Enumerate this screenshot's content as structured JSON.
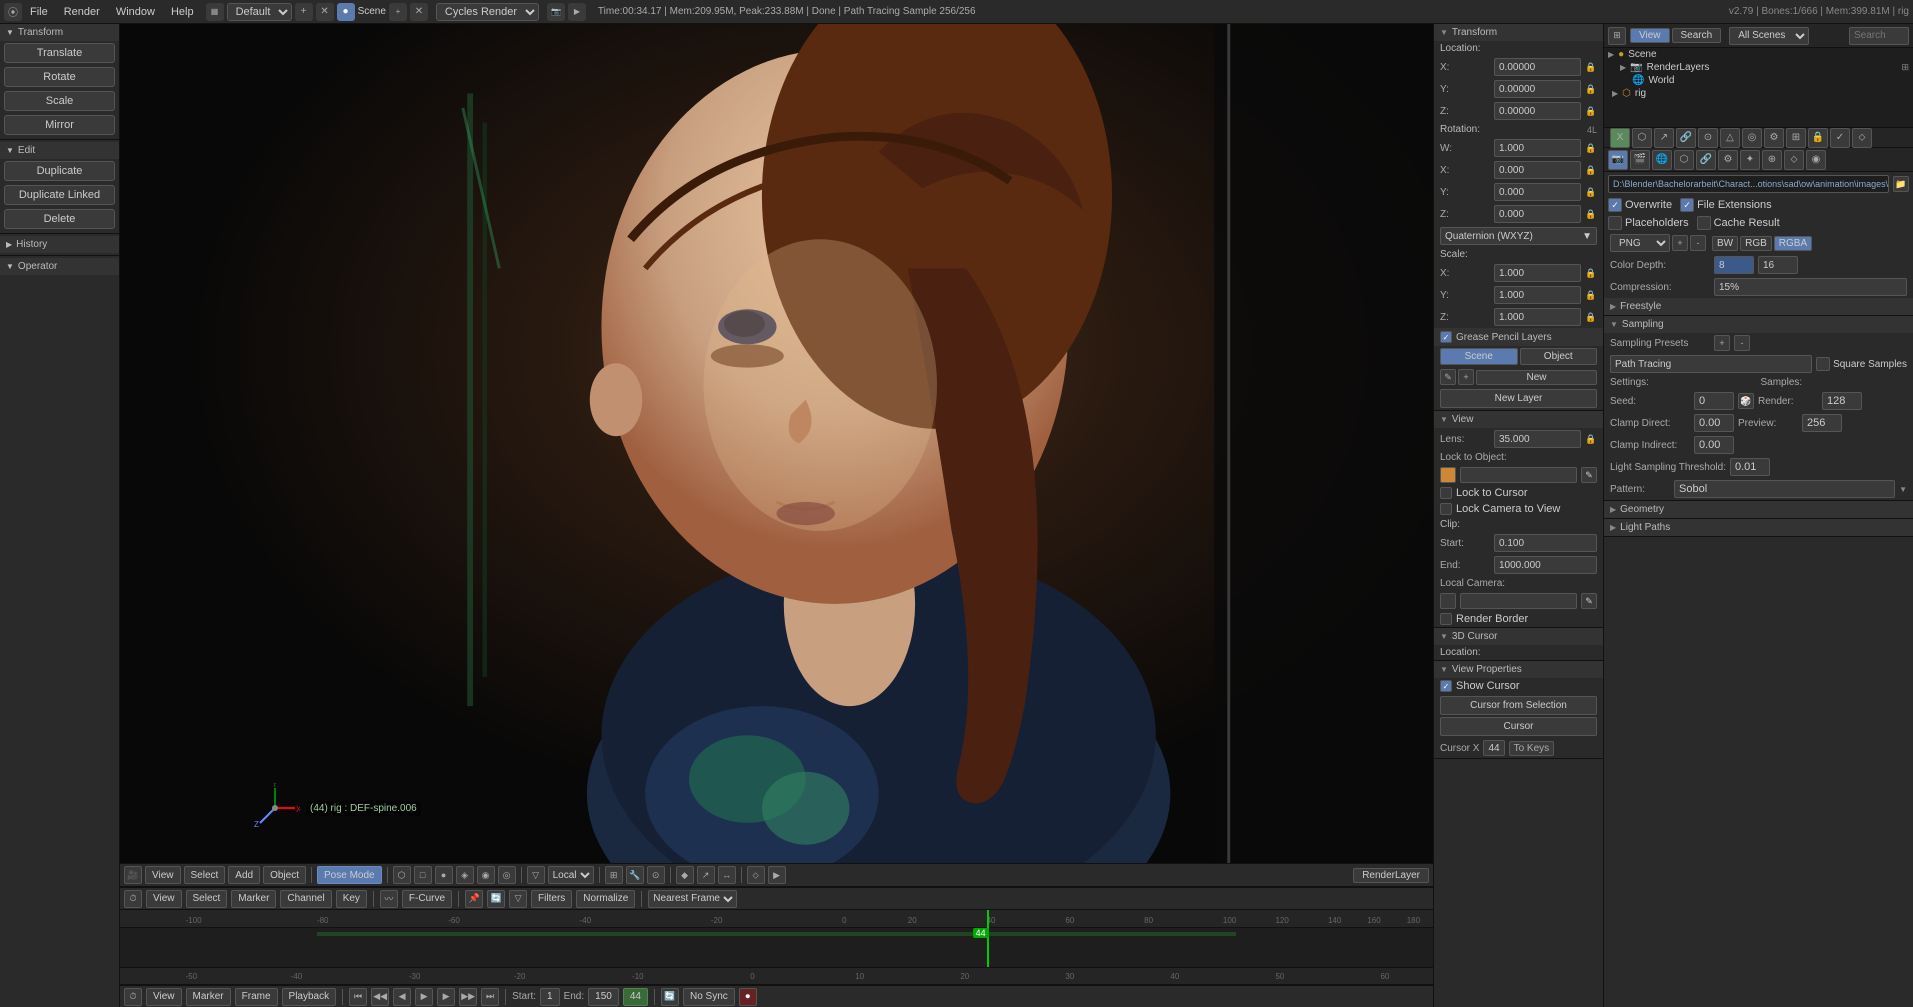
{
  "topbar": {
    "version": "v2.79",
    "engine": "Cycles Render",
    "scene": "Scene",
    "layout": "Default",
    "status": "Time:00:34.17 | Mem:209.95M, Peak:233.88M | Done | Path Tracing Sample 256/256",
    "version_info": "v2.79 | Bones:1/666 | Mem:399.81M | rig",
    "menus": [
      "File",
      "Render",
      "Window",
      "Help"
    ]
  },
  "left_panel": {
    "transform_header": "Transform",
    "edit_header": "Edit",
    "history_header": "History",
    "operator_header": "Operator",
    "btns": {
      "translate": "Translate",
      "rotate": "Rotate",
      "scale": "Scale",
      "mirror": "Mirror",
      "duplicate": "Duplicate",
      "duplicate_linked": "Duplicate Linked",
      "delete": "Delete"
    }
  },
  "right_panel": {
    "transform": {
      "header": "Transform",
      "location_header": "Location:",
      "location": {
        "x": "0.00000",
        "y": "0.00000",
        "z": "0.00000"
      },
      "rotation_header": "Rotation:",
      "rotation_label": "4L",
      "rotation": {
        "w": "1.000",
        "x": "0.000",
        "y": "0.000",
        "z": "0.000"
      },
      "rotation_mode": "Quaternion (WXYZ)",
      "scale_header": "Scale:",
      "scale": {
        "x": "1.000",
        "y": "1.000",
        "z": "1.000"
      }
    },
    "grease_pencil": {
      "header": "Grease Pencil Layers",
      "scene_btn": "Scene",
      "object_btn": "Object",
      "new_btn": "New",
      "new_layer_btn": "New Layer"
    },
    "view": {
      "header": "View",
      "lens_label": "Lens:",
      "lens_value": "35.000",
      "lock_to_object": "Lock to Object:",
      "lock_to_cursor": "Lock to Cursor",
      "lock_camera_to_view": "Lock Camera to View",
      "clip_header": "Clip:",
      "start_label": "Start:",
      "start_value": "0.100",
      "end_label": "End:",
      "end_value": "1000.000",
      "local_camera": "Local Camera:",
      "render_border": "Render Border",
      "cursor_3d": "3D Cursor",
      "location_sub": "Location:"
    },
    "view_properties": {
      "header": "View Properties",
      "show_cursor": "Show Cursor",
      "cursor_from_selection": "Cursor from Selection",
      "cursor_label": "Cursor",
      "cursor_x_label": "Cursor X",
      "cursor_x_value": "44",
      "to_keys": "To Keys"
    }
  },
  "viewport": {
    "mode": "Pose Mode",
    "view_btn": "View",
    "select_btn": "Select",
    "add_btn": "Add",
    "object_btn": "Object",
    "local_btn": "Local",
    "render_layer": "RenderLayer",
    "bone_info": "(44) rig : DEF-spine.006"
  },
  "timeline": {
    "header": {
      "view_btn": "View",
      "select_btn": "Select",
      "marker_btn": "Marker",
      "channel_btn": "Channel",
      "key_btn": "Key",
      "fcurve_btn": "F-Curve",
      "filters_btn": "Filters",
      "normalize_btn": "Normalize",
      "nearest_frame": "Nearest Frame",
      "frame_numbers": [
        "-100",
        "-80",
        "-60",
        "-40",
        "-20",
        "0",
        "20",
        "40",
        "60",
        "80",
        "100",
        "120",
        "140",
        "160",
        "180"
      ],
      "playhead_position": "44"
    },
    "footer": {
      "view_btn": "View",
      "marker_btn": "Marker",
      "frame_btn": "Frame",
      "playback_btn": "Playback",
      "start_label": "Start:",
      "start_value": "1",
      "end_label": "End:",
      "end_value": "150",
      "current": "44",
      "no_sync": "No Sync"
    }
  },
  "far_right": {
    "view_tab": "View",
    "search_placeholder": "Search",
    "outliner": {
      "scene": "Scene",
      "render_layers": "RenderLayers",
      "world": "World"
    },
    "file_path": "D:\\Blender\\Bachelorarbeit\\Charact...otions\\sad\\ow\\animation\\images\\",
    "overwrite": "Overwrite",
    "file_extensions": "File Extensions",
    "placeholders": "Placeholders",
    "cache_result": "Cache Result",
    "format": "PNG",
    "bw_btn": "BW",
    "rgb_btn": "RGB",
    "rgba_btn": "RGBA",
    "color_depth_label": "Color Depth:",
    "color_depth_8": "8",
    "color_depth_16": "16",
    "compression_label": "Compression:",
    "compression_value": "15%",
    "freestyle_header": "Freestyle",
    "sampling_header": "Sampling",
    "sampling_presets_label": "Sampling Presets",
    "path_tracing": "Path Tracing",
    "square_samples": "Square Samples",
    "settings_label": "Settings:",
    "samples_label": "Samples:",
    "seed_label": "Seed:",
    "seed_value": "0",
    "render_label": "Render:",
    "render_value": "128",
    "clamp_direct_label": "Clamp Direct:",
    "clamp_direct_value": "0.00",
    "preview_label": "Preview:",
    "preview_value": "256",
    "clamp_indirect_label": "Clamp Indirect:",
    "clamp_indirect_value": "0.00",
    "light_threshold_label": "Light Sampling Threshold:",
    "light_threshold_value": "0.01",
    "pattern_label": "Pattern:",
    "pattern_value": "Sobol",
    "geometry_header": "Geometry",
    "light_paths_header": "Light Paths",
    "tracing_label": "Tracing",
    "scene_object_label": "Scene Object",
    "new_label": "New",
    "new_layer_label": "New Layer",
    "lock_to_cursor_label": "Lock to Cursor",
    "cursor_from_selection_label": "Cursor from Selection",
    "cursor_label2": "Cursor"
  }
}
